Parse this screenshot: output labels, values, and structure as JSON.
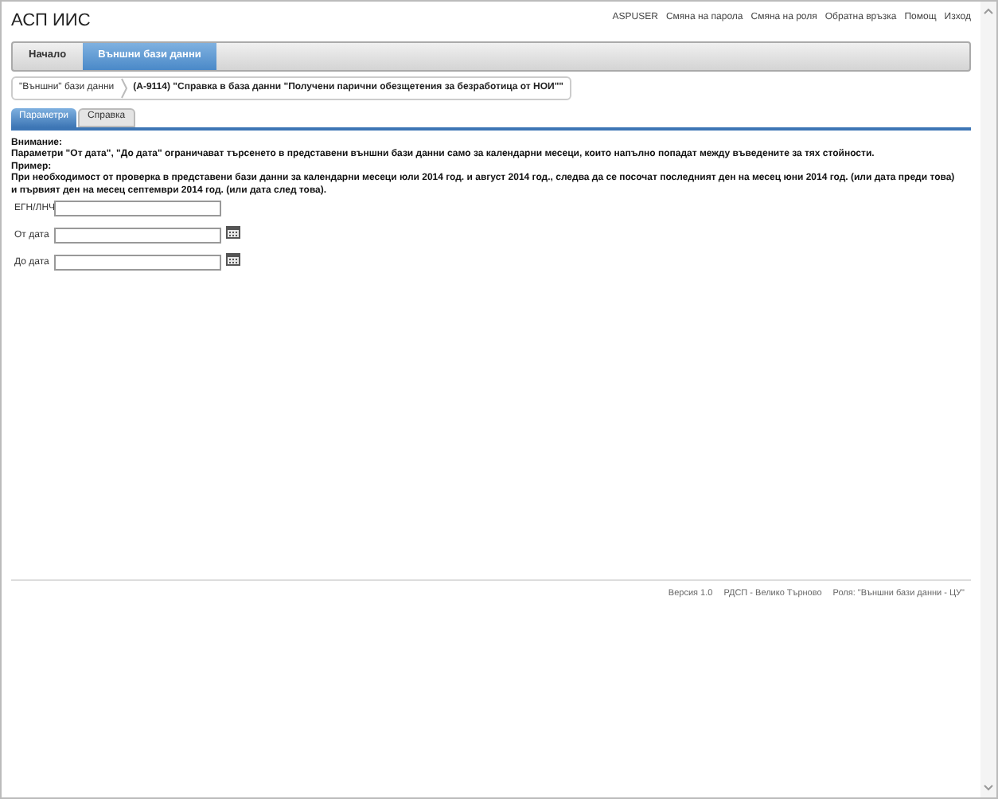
{
  "app_title": "АСП ИИС",
  "user_links": [
    "ASPUSER",
    "Смяна на парола",
    "Смяна на роля",
    "Обратна връзка",
    "Помощ",
    "Изход"
  ],
  "nav_tabs": [
    {
      "label": "Начало",
      "selected": false
    },
    {
      "label": "Външни бази данни",
      "selected": true
    }
  ],
  "breadcrumbs": [
    "\"Външни\" бази данни",
    "(А-9114) \"Справка в база данни \"Получени парични обезщетения за безработица от НОИ\"\""
  ],
  "sub_tabs": [
    {
      "label": "Параметри",
      "selected": true
    },
    {
      "label": "Справка",
      "selected": false
    }
  ],
  "notice": [
    "Внимание:",
    "Параметри \"От дата\", \"До дата\" ограничават търсенето в представени външни бази данни само за календарни месеци, които напълно попадат между въведените за тях стойности.",
    "Пример:",
    "При необходимост от проверка в представени бази данни за календарни месеци юли 2014 год. и август 2014 год., следва да се посочат последният ден на месец юни 2014 год. (или дата преди това) и първият ден на месец септември 2014 год. (или дата след това)."
  ],
  "fields": [
    {
      "label": "ЕГН/ЛНЧ",
      "kind": "text"
    },
    {
      "label": "От дата",
      "kind": "date"
    },
    {
      "label": "До дата",
      "kind": "date"
    }
  ],
  "footer": [
    "Версия 1.0",
    "РДСП - Велико Търново",
    "Роля: \"Външни бази данни - ЦУ\""
  ]
}
